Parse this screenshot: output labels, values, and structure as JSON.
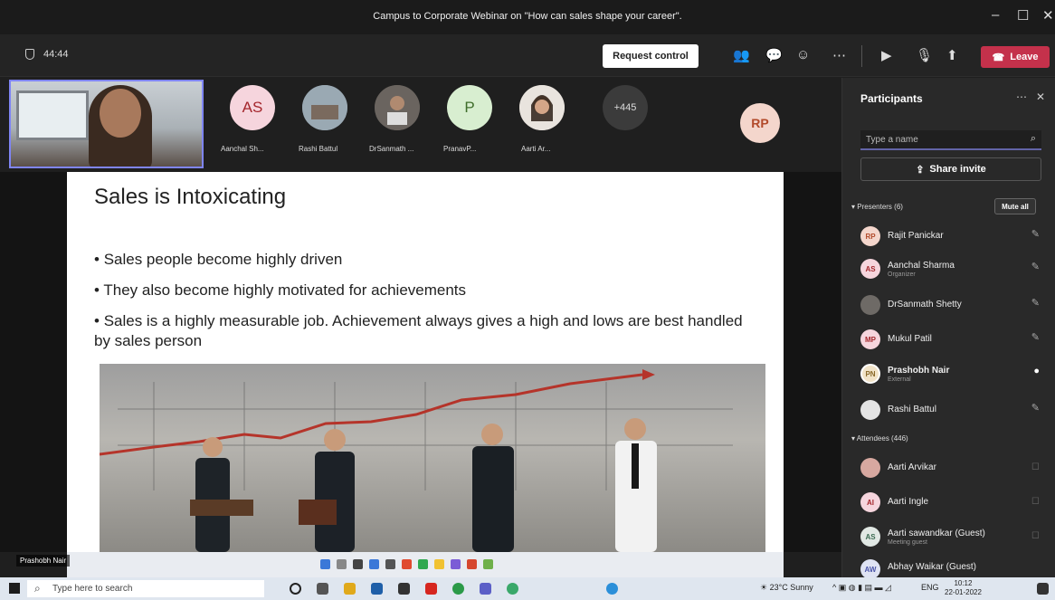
{
  "window": {
    "title": "Campus to Corporate Webinar on \"How can sales shape your career\".",
    "minimize": "–",
    "maximize": "☐",
    "close": "✕"
  },
  "meeting": {
    "timer": "44:44",
    "request_control": "Request control",
    "leave": "Leave"
  },
  "gallery": {
    "participants": [
      {
        "initials": "AS",
        "name": "Aanchal Sh...",
        "bg": "#f6d5dd",
        "fg": "#a4262c"
      },
      {
        "initials": "",
        "name": "Rashi Battul",
        "bg": "#8a9ba8",
        "fg": "#fff"
      },
      {
        "initials": "",
        "name": "DrSanmath ...",
        "bg": "#5f5a55",
        "fg": "#fff"
      },
      {
        "initials": "P",
        "name": "PranavP...",
        "bg": "#d8eed0",
        "fg": "#3f6d2b"
      },
      {
        "initials": "",
        "name": "Aarti Ar...",
        "bg": "#cfc3b8",
        "fg": "#fff"
      }
    ],
    "more": "+445",
    "spotlight": "RP"
  },
  "slide": {
    "title": "Sales is Intoxicating",
    "bullets": [
      "Sales people become highly driven",
      "They also become highly motivated for achievements",
      "Sales is a highly measurable job. Achievement always gives a high and lows are best handled by sales person"
    ]
  },
  "presenter_tag": "Prashobh Nair",
  "panel": {
    "title": "Participants",
    "search_placeholder": "Type a name",
    "share_invite": "Share invite",
    "presenters_header": "Presenters (6)",
    "mute_all": "Mute all",
    "presenters": [
      {
        "initials": "RP",
        "name": "Rajit Panickar",
        "sub": "",
        "bg": "#f4d6cc",
        "fg": "#b24a2a"
      },
      {
        "initials": "AS",
        "name": "Aanchal Sharma",
        "sub": "Organizer",
        "bg": "#f6d5dd",
        "fg": "#a4262c"
      },
      {
        "initials": "",
        "name": "DrSanmath Shetty",
        "sub": "",
        "bg": "#6e6a66",
        "fg": "#fff"
      },
      {
        "initials": "MP",
        "name": "Mukul Patil",
        "sub": "",
        "bg": "#f6d5dd",
        "fg": "#a4262c"
      },
      {
        "initials": "PN",
        "name": "Prashobh Nair",
        "sub": "External",
        "bg": "#f1e3c8",
        "fg": "#8a6a2a"
      },
      {
        "initials": "",
        "name": "Rashi Battul",
        "sub": "",
        "bg": "#e4e4e4",
        "fg": "#333"
      }
    ],
    "attendees_header": "Attendees (446)",
    "attendees": [
      {
        "initials": "",
        "name": "Aarti Arvikar",
        "sub": "",
        "bg": "#d7a8a0",
        "fg": "#fff"
      },
      {
        "initials": "AI",
        "name": "Aarti Ingle",
        "sub": "",
        "bg": "#f6d5dd",
        "fg": "#a4262c"
      },
      {
        "initials": "AS",
        "name": "Aarti sawandkar (Guest)",
        "sub": "Meeting guest",
        "bg": "#e1e8e4",
        "fg": "#3b6b52"
      },
      {
        "initials": "AW",
        "name": "Abhay Waikar (Guest)",
        "sub": "",
        "bg": "#dfe3f3",
        "fg": "#4a54a8"
      }
    ]
  },
  "taskbar": {
    "search_placeholder": "Type here to search",
    "weather": "23°C  Sunny",
    "lang": "ENG",
    "time": "10:12",
    "date": "22-01-2022"
  }
}
